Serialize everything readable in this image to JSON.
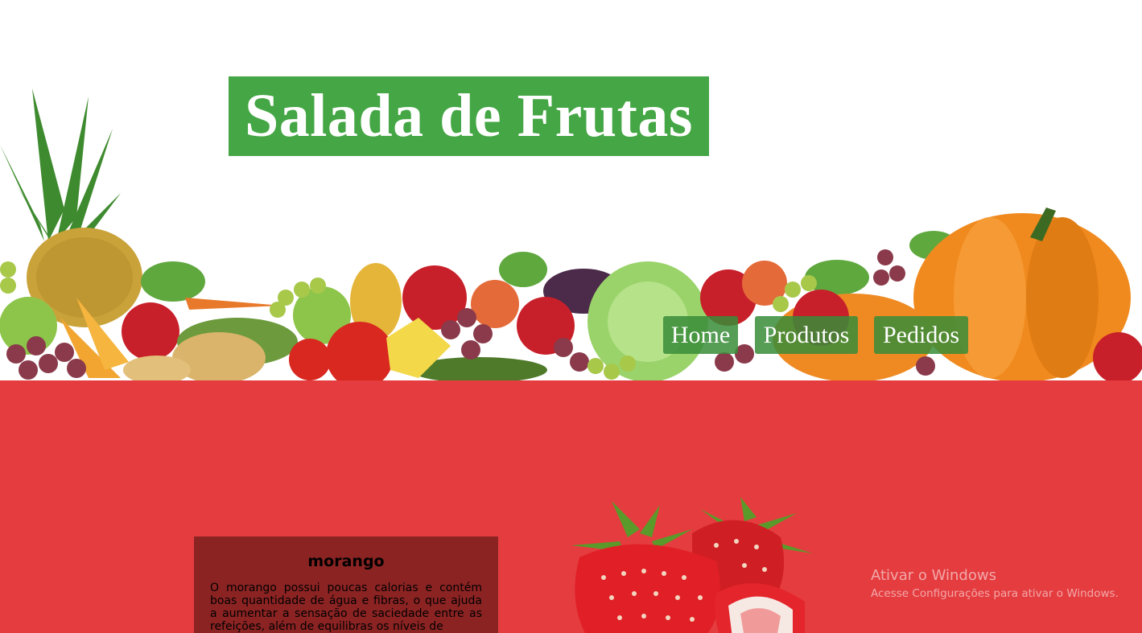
{
  "header": {
    "title": "Salada de Frutas",
    "banner_image": "fruit-and-vegetable-banner"
  },
  "nav": {
    "items": [
      {
        "label": "Home"
      },
      {
        "label": "Produtos"
      },
      {
        "label": "Pedidos"
      }
    ]
  },
  "product": {
    "name": "morango",
    "description": "O morango possui poucas calorias e contém boas quantidade de água e fibras, o que ajuda a aumentar a sensação de saciedade entre as refeições, além de equilibras os níveis de",
    "image": "strawberries-photo"
  },
  "os_watermark": {
    "title": "Ativar o Windows",
    "subtitle": "Acesse Configurações para ativar o Windows."
  },
  "colors": {
    "title_bg": "#44a644",
    "nav_bg": "#388c38",
    "section_bg": "#e43c3f",
    "card_bg": "#8c2323"
  }
}
